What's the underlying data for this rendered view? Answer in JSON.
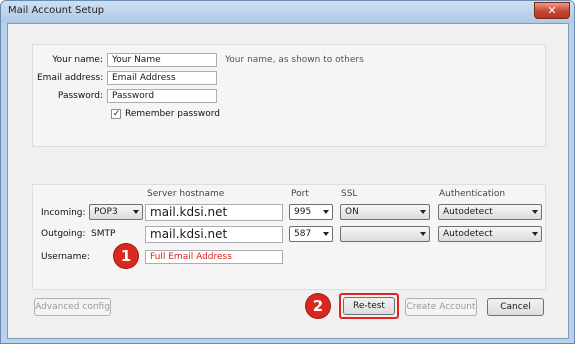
{
  "window": {
    "title": "Mail Account Setup",
    "close_glyph": "✕"
  },
  "account": {
    "name_label": "Your name:",
    "name_value": "Your Name",
    "name_hint": "Your name, as shown to others",
    "email_label": "Email address:",
    "email_value": "Email Address",
    "password_label": "Password:",
    "password_value": "Password",
    "remember_label": "Remember password",
    "remember_checked": true
  },
  "server": {
    "headers": {
      "hostname": "Server hostname",
      "port": "Port",
      "ssl": "SSL",
      "auth": "Authentication"
    },
    "incoming": {
      "label": "Incoming:",
      "protocol": "POP3",
      "hostname": "mail.kdsi.net",
      "port": "995",
      "ssl": "ON",
      "auth": "Autodetect"
    },
    "outgoing": {
      "label": "Outgoing:",
      "protocol": "SMTP",
      "hostname": "mail.kdsi.net",
      "port": "587",
      "ssl": "",
      "auth": "Autodetect"
    },
    "username": {
      "label": "Username:",
      "value": "Full Email Address"
    }
  },
  "buttons": {
    "advanced_config": "Advanced config",
    "retest": "Re-test",
    "create_account": "Create Account",
    "cancel": "Cancel"
  },
  "callouts": [
    {
      "number": "1",
      "color": "#d9281f"
    },
    {
      "number": "2",
      "color": "#d9281f"
    }
  ]
}
